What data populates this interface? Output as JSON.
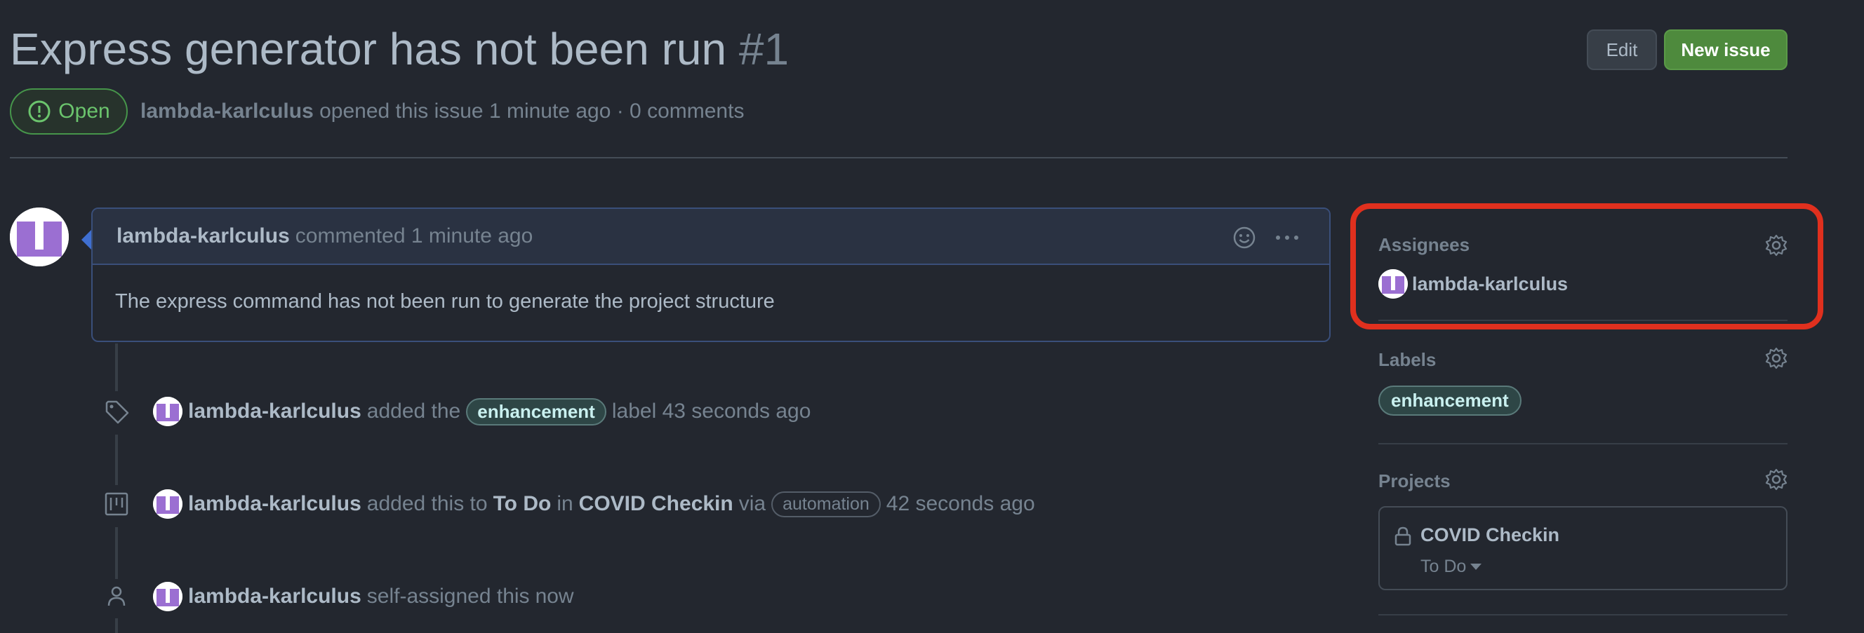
{
  "issue": {
    "title": "Express generator has not been run",
    "number": "#1",
    "state": "Open",
    "author": "lambda-karlculus",
    "meta_text": "opened this issue 1 minute ago · 0 comments"
  },
  "header_actions": {
    "edit_label": "Edit",
    "new_issue_label": "New issue"
  },
  "comment": {
    "author": "lambda-karlculus",
    "time_text": "commented 1 minute ago",
    "body": "The express command has not been run to generate the project structure",
    "reaction_icon": "smiley-icon",
    "more_icon": "kebab-horizontal-icon"
  },
  "timeline": [
    {
      "icon": "tag-icon",
      "author": "lambda-karlculus",
      "prefix": "added the",
      "label": "enhancement",
      "suffix": "label 43 seconds ago"
    },
    {
      "icon": "project-icon",
      "author": "lambda-karlculus",
      "prefix": "added this to",
      "column": "To Do",
      "in_text": "in",
      "project": "COVID Checkin",
      "via_text": "via",
      "badge": "automation",
      "suffix": "42 seconds ago"
    },
    {
      "icon": "person-icon",
      "author": "lambda-karlculus",
      "text": "self-assigned this",
      "time": "now"
    }
  ],
  "sidebar": {
    "assignees": {
      "heading": "Assignees",
      "user": "lambda-karlculus"
    },
    "labels": {
      "heading": "Labels",
      "items": [
        "enhancement"
      ]
    },
    "projects": {
      "heading": "Projects",
      "name": "COVID Checkin",
      "column": "To Do"
    }
  },
  "colors": {
    "background": "#23272f",
    "open_green": "#6bc46d",
    "new_issue_button": "#4e8a3d",
    "highlight_red": "#e0301e",
    "label_bg": "#2e4646"
  }
}
